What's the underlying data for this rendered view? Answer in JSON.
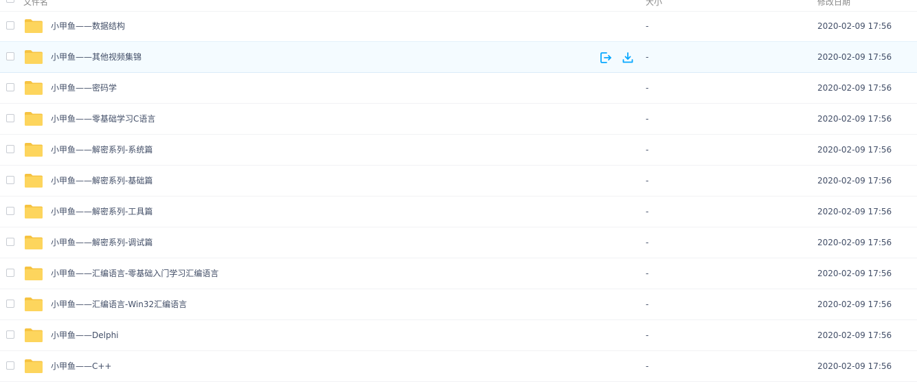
{
  "header": {
    "name": "文件名",
    "size": "大小",
    "date": "修改日期"
  },
  "accent_color": "#06a7ff",
  "folder_color": "#fdd55d",
  "rows": [
    {
      "name": "小甲鱼——数据结构",
      "size": "-",
      "date": "2020-02-09 17:56",
      "hovered": false
    },
    {
      "name": "小甲鱼——其他视频集锦",
      "size": "-",
      "date": "2020-02-09 17:56",
      "hovered": true,
      "actions": [
        "share-icon",
        "download-icon"
      ]
    },
    {
      "name": "小甲鱼——密码学",
      "size": "-",
      "date": "2020-02-09 17:56",
      "hovered": false
    },
    {
      "name": "小甲鱼——零基础学习C语言",
      "size": "-",
      "date": "2020-02-09 17:56",
      "hovered": false
    },
    {
      "name": "小甲鱼——解密系列-系统篇",
      "size": "-",
      "date": "2020-02-09 17:56",
      "hovered": false
    },
    {
      "name": "小甲鱼——解密系列-基础篇",
      "size": "-",
      "date": "2020-02-09 17:56",
      "hovered": false
    },
    {
      "name": "小甲鱼——解密系列-工具篇",
      "size": "-",
      "date": "2020-02-09 17:56",
      "hovered": false
    },
    {
      "name": "小甲鱼——解密系列-调试篇",
      "size": "-",
      "date": "2020-02-09 17:56",
      "hovered": false
    },
    {
      "name": "小甲鱼——汇编语言-零基础入门学习汇编语言",
      "size": "-",
      "date": "2020-02-09 17:56",
      "hovered": false
    },
    {
      "name": "小甲鱼——汇编语言-Win32汇编语言",
      "size": "-",
      "date": "2020-02-09 17:56",
      "hovered": false
    },
    {
      "name": "小甲鱼——Delphi",
      "size": "-",
      "date": "2020-02-09 17:56",
      "hovered": false
    },
    {
      "name": "小甲鱼——C++",
      "size": "-",
      "date": "2020-02-09 17:56",
      "hovered": false
    }
  ]
}
